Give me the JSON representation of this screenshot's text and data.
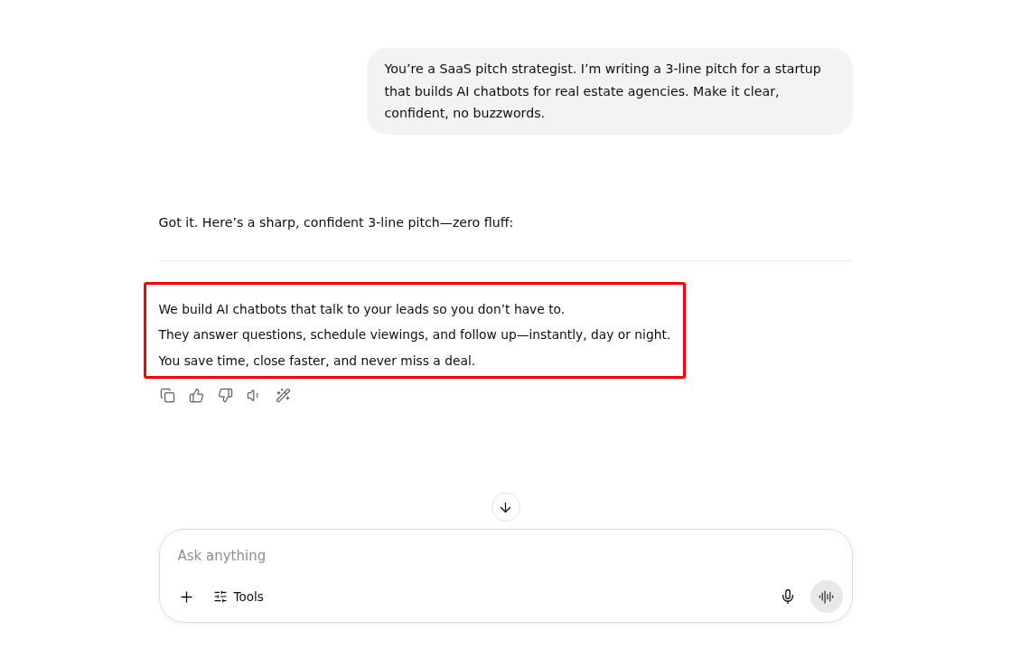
{
  "user_message": "You’re a SaaS pitch strategist. I’m writing a 3-line pitch for a startup that builds AI chatbots for real estate agencies. Make it clear, confident, no buzzwords.",
  "assistant": {
    "intro": "Got it. Here’s a sharp, confident 3-line pitch—zero fluff:",
    "pitch_lines": [
      "We build AI chatbots that talk to your leads so you don’t have to.",
      "They answer questions, schedule viewings, and follow up—instantly, day or night.",
      "You save time, close faster, and never miss a deal."
    ]
  },
  "composer": {
    "placeholder": "Ask anything",
    "tools_label": "Tools"
  }
}
